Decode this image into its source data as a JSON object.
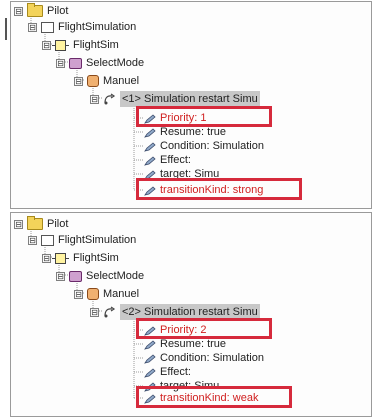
{
  "panels": [
    {
      "root": "Pilot",
      "project": "FlightSimulation",
      "system": "FlightSim",
      "mode": "SelectMode",
      "state": "Manuel",
      "transition": "<1> Simulation restart Simu",
      "properties": [
        "Priority: 1",
        "Resume: true",
        "Condition: Simulation",
        "Effect:",
        "target: Simu",
        "transitionKind: strong"
      ]
    },
    {
      "root": "Pilot",
      "project": "FlightSimulation",
      "system": "FlightSim",
      "mode": "SelectMode",
      "state": "Manuel",
      "transition": "<2> Simulation restart Simu",
      "properties": [
        "Priority: 2",
        "Resume: true",
        "Condition: Simulation",
        "Effect:",
        "target: Simu",
        "transitionKind: weak"
      ]
    }
  ],
  "expander_symbol": "⊟",
  "colors": {
    "highlight_border": "#d62a3c",
    "highlight_text": "#d02020",
    "selection_bg": "#c8c8c8"
  }
}
